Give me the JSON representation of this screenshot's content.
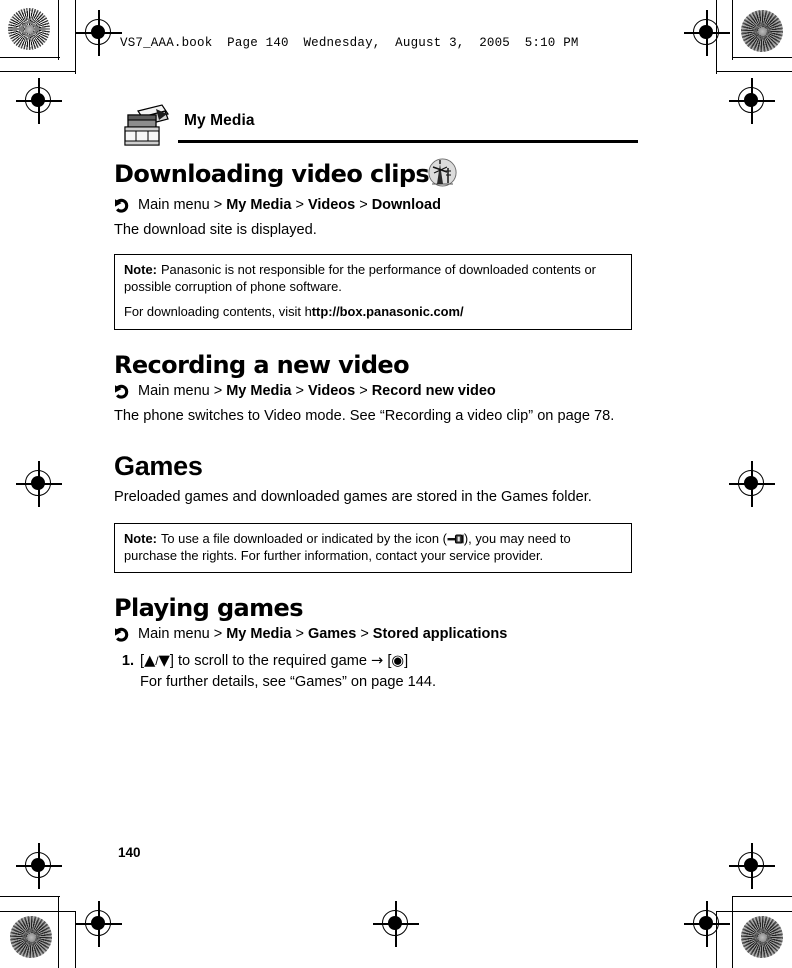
{
  "file_header": {
    "filename": "VS7_AAA.book",
    "page_label": "Page 140",
    "weekday": "Wednesday,",
    "month_day": "August 3,",
    "year": "2005",
    "time": "5:10 PM"
  },
  "chapter": {
    "title": "My Media",
    "icon": "media-folder-icon"
  },
  "sections": {
    "downloading": {
      "heading": "Downloading video clips",
      "heading_icon": "download-antenna-icon",
      "crumb": {
        "icon": "curved-arrow-icon",
        "root": "Main menu",
        "sep": ">",
        "part1": "My Media",
        "part2": "Videos",
        "part3": "Download"
      },
      "body": "The download site is displayed.",
      "note": {
        "label": "Note:",
        "line1": "Panasonic is not responsible for the performance of downloaded contents or possible corruption of phone software.",
        "line2_prefix": "For downloading contents, visit h",
        "line2_url": "ttp://box.panasonic.com/"
      }
    },
    "recording": {
      "heading": "Recording a new video",
      "crumb": {
        "icon": "curved-arrow-icon",
        "root": "Main menu",
        "sep": ">",
        "part1": "My Media",
        "part2": "Videos",
        "part3": "Record new video"
      },
      "body": "The phone switches to Video mode. See “Recording a video clip” on page 78."
    },
    "games": {
      "heading": "Games",
      "body": "Preloaded games and downloaded games are stored in the Games folder.",
      "note": {
        "label": "Note:",
        "text_before_icon": "To use a file downloaded or indicated by the icon (",
        "icon": "key-icon",
        "text_after_icon": "), you may need to purchase the rights. For further information, contact your service provider."
      }
    },
    "playing_games": {
      "heading": "Playing games",
      "crumb": {
        "icon": "curved-arrow-icon",
        "root": "Main menu",
        "sep": ">",
        "part1": "My Media",
        "part2": "Games",
        "part3": "Stored applications"
      },
      "steps": [
        {
          "number": "1.",
          "text_open": "[",
          "up_glyph": "▲",
          "slash": "/",
          "down_glyph": "▼",
          "text_mid": "] to scroll to the required game ",
          "arrow_glyph": "→",
          "select_open": " [",
          "select_glyph": "◉",
          "select_close": "]",
          "sub": "For further details, see “Games” on page 144."
        }
      ]
    }
  },
  "folio": "140"
}
